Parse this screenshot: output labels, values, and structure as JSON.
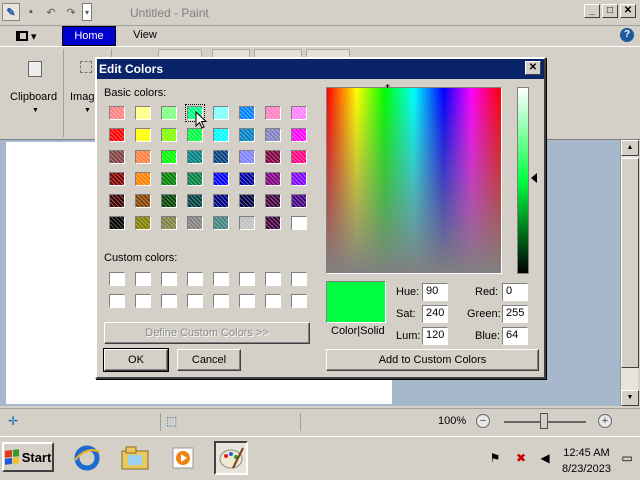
{
  "window": {
    "title": "Untitled - Paint",
    "controls": {
      "minimize": "_",
      "maximize": "□",
      "close": "✕"
    }
  },
  "ribbon": {
    "file_menu_glyph": "▾",
    "tabs": [
      {
        "label": "Home",
        "active": true
      },
      {
        "label": "View",
        "active": false
      }
    ],
    "help": "?",
    "groups": [
      {
        "label": "Clipboard"
      },
      {
        "label": "Imag"
      }
    ]
  },
  "dialog": {
    "title": "Edit Colors",
    "close": "✕",
    "basic_colors_label": "Basic colors:",
    "custom_colors_label": "Custom colors:",
    "define_custom_label": "Define Custom Colors >>",
    "ok_label": "OK",
    "cancel_label": "Cancel",
    "color_solid_label": "Color|Solid",
    "add_custom_label": "Add to Custom Colors",
    "basic_colors": [
      [
        "#ff8080",
        "#ffff80",
        "#80ff80",
        "#00ff80",
        "#80ffff",
        "#0080ff",
        "#ff80c0",
        "#ff80ff"
      ],
      [
        "#ff0000",
        "#ffff00",
        "#80ff00",
        "#00ff40",
        "#00ffff",
        "#0080c0",
        "#8080c0",
        "#ff00ff"
      ],
      [
        "#804040",
        "#ff8040",
        "#00ff00",
        "#008080",
        "#004080",
        "#8080ff",
        "#800040",
        "#ff0080"
      ],
      [
        "#800000",
        "#ff8000",
        "#008000",
        "#008040",
        "#0000ff",
        "#0000a0",
        "#800080",
        "#8000ff"
      ],
      [
        "#400000",
        "#804000",
        "#004000",
        "#004040",
        "#000080",
        "#000040",
        "#400040",
        "#400080"
      ],
      [
        "#000000",
        "#808000",
        "#808040",
        "#808080",
        "#408080",
        "#c0c0c0",
        "#400040",
        "#ffffff"
      ]
    ],
    "selected_swatch": [
      0,
      3
    ],
    "custom_colors": [
      "#ffffff",
      "#ffffff",
      "#ffffff",
      "#ffffff",
      "#ffffff",
      "#ffffff",
      "#ffffff",
      "#ffffff",
      "#ffffff",
      "#ffffff",
      "#ffffff",
      "#ffffff",
      "#ffffff",
      "#ffffff",
      "#ffffff",
      "#ffffff"
    ],
    "preview_color": "#00ff40",
    "hsl": {
      "hue_label": "Hue:",
      "hue": "90",
      "sat_label": "Sat:",
      "sat": "240",
      "lum_label": "Lum:",
      "lum": "120"
    },
    "rgb": {
      "red_label": "Red:",
      "red": "0",
      "green_label": "Green:",
      "green": "255",
      "blue_label": "Blue:",
      "blue": "64"
    }
  },
  "status": {
    "zoom": "100%",
    "zoom_minus": "−",
    "zoom_plus": "+",
    "zoom_level": 0.5
  },
  "taskbar": {
    "start_label": "Start",
    "time": "12:45 AM",
    "date": "8/23/2023"
  }
}
